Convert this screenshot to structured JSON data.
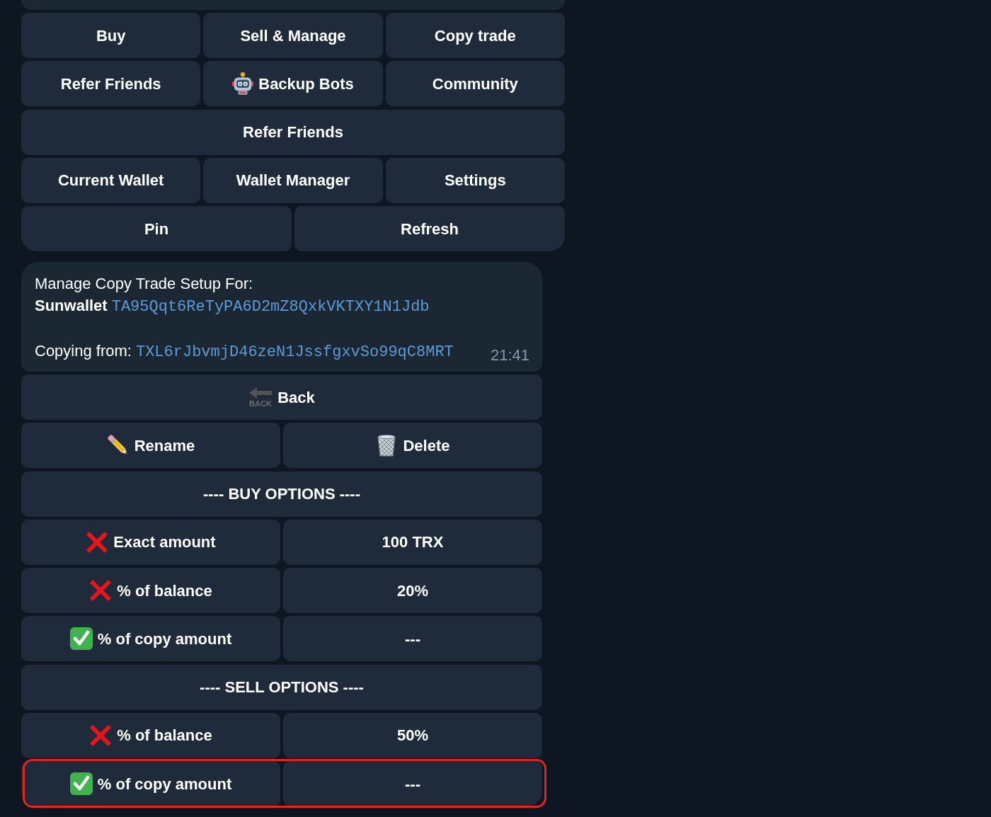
{
  "previous_message": {
    "visible": true
  },
  "main_keyboard": {
    "rows": [
      {
        "buttons": [
          {
            "kind": "text",
            "label": "Buy"
          },
          {
            "kind": "text",
            "label": "Sell & Manage"
          },
          {
            "kind": "text",
            "label": "Copy trade"
          }
        ]
      },
      {
        "buttons": [
          {
            "kind": "text",
            "label": "Refer Friends"
          },
          {
            "kind": "robot",
            "label": "Backup Bots"
          },
          {
            "kind": "text",
            "label": "Community"
          }
        ]
      },
      {
        "buttons": [
          {
            "kind": "text",
            "label": "Refer Friends"
          }
        ]
      },
      {
        "buttons": [
          {
            "kind": "text",
            "label": "Current Wallet"
          },
          {
            "kind": "text",
            "label": "Wallet Manager"
          },
          {
            "kind": "text",
            "label": "Settings"
          }
        ]
      },
      {
        "buttons": [
          {
            "kind": "text",
            "label": "Pin"
          },
          {
            "kind": "text",
            "label": "Refresh"
          }
        ]
      }
    ]
  },
  "message": {
    "heading": "Manage Copy Trade Setup For:",
    "wallet_name": "Sunwallet",
    "wallet_address": "TA95Qqt6ReTyPA6D2mZ8QxkVKTXY1N1Jdb",
    "copying_label": "Copying from:",
    "copying_address": "TXL6rJbvmjD46zeN1JssfgxvSo99qC8MRT",
    "time": "21:41"
  },
  "setup_keyboard": {
    "rows": [
      {
        "highlighted": false,
        "buttons": [
          {
            "kind": "back",
            "icon_text": "BACK",
            "label": "Back"
          }
        ]
      },
      {
        "highlighted": false,
        "buttons": [
          {
            "kind": "pencil",
            "label": "Rename"
          },
          {
            "kind": "bin",
            "label": "Delete"
          }
        ]
      },
      {
        "highlighted": false,
        "buttons": [
          {
            "kind": "header",
            "label": "---- BUY OPTIONS ----"
          }
        ]
      },
      {
        "highlighted": false,
        "buttons": [
          {
            "kind": "toggle",
            "checked": false,
            "label": "Exact amount"
          },
          {
            "kind": "value",
            "label": "100 TRX"
          }
        ]
      },
      {
        "highlighted": false,
        "buttons": [
          {
            "kind": "toggle",
            "checked": false,
            "label": "% of balance"
          },
          {
            "kind": "value",
            "label": "20%"
          }
        ]
      },
      {
        "highlighted": false,
        "buttons": [
          {
            "kind": "toggle",
            "checked": true,
            "label": "% of copy amount"
          },
          {
            "kind": "value",
            "label": "---"
          }
        ]
      },
      {
        "highlighted": false,
        "buttons": [
          {
            "kind": "header",
            "label": "---- SELL OPTIONS ----"
          }
        ]
      },
      {
        "highlighted": false,
        "buttons": [
          {
            "kind": "toggle",
            "checked": false,
            "label": "% of balance"
          },
          {
            "kind": "value",
            "label": "50%"
          }
        ]
      },
      {
        "highlighted": true,
        "buttons": [
          {
            "kind": "toggle",
            "checked": true,
            "label": "% of copy amount"
          },
          {
            "kind": "value",
            "label": "---"
          }
        ]
      }
    ]
  }
}
